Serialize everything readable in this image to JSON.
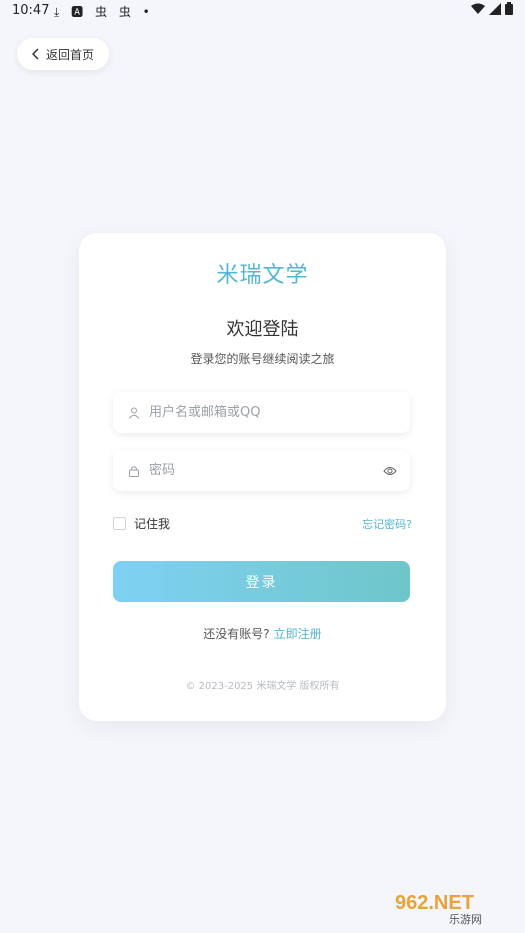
{
  "status_bar": {
    "time": "10:47",
    "left_icons": [
      "download-icon",
      "a-icon",
      "bug-icon",
      "bug-icon",
      "dot-icon"
    ],
    "right_icons": [
      "wifi-icon",
      "signal-icon",
      "battery-icon"
    ]
  },
  "header": {
    "back_label": "返回首页"
  },
  "card": {
    "brand": "米瑞文学",
    "title": "欢迎登陆",
    "subtitle": "登录您的账号继续阅读之旅",
    "username_placeholder": "用户名或邮箱或QQ",
    "password_placeholder": "密码",
    "remember_label": "记住我",
    "forgot_label": "忘记密码?",
    "login_label": "登录",
    "register_prompt": "还没有账号?",
    "register_link": "立即注册",
    "copyright": "© 2023-2025 米瑞文学 版权所有"
  },
  "watermark": {
    "text": "962.NET",
    "subtext": "乐游网"
  },
  "colors": {
    "accent": "#54b6d2",
    "button_start": "#7fd1f4",
    "button_end": "#6ec6c9",
    "background": "#f4f6fb"
  }
}
